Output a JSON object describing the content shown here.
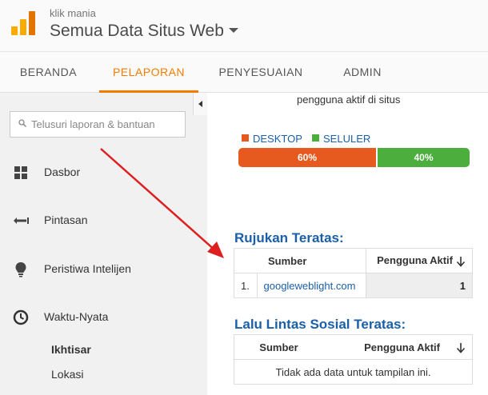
{
  "header": {
    "account": "klik mania",
    "property": "Semua Data Situs Web"
  },
  "nav": {
    "tabs": [
      {
        "label": "BERANDA"
      },
      {
        "label": "PELAPORAN"
      },
      {
        "label": "PENYESUAIAN"
      },
      {
        "label": "ADMIN"
      }
    ],
    "active_tab": "PELAPORAN"
  },
  "sidebar": {
    "search_placeholder": "Telusuri laporan & bantuan",
    "items": [
      {
        "label": "Dasbor",
        "icon": "grid-icon"
      },
      {
        "label": "Pintasan",
        "icon": "shortcut-arrow-icon"
      },
      {
        "label": "Peristiwa Intelijen",
        "icon": "lightbulb-icon"
      },
      {
        "label": "Waktu-Nyata",
        "icon": "clock-icon"
      }
    ],
    "subitems": [
      {
        "label": "Ikhtisar",
        "selected": true
      },
      {
        "label": "Lokasi",
        "selected": false
      }
    ]
  },
  "main": {
    "active_users_caption": "pengguna aktif di situs",
    "device_legend": {
      "desktop": "DESKTOP",
      "mobile": "SELULER"
    },
    "device_split": {
      "desktop_label": "60%",
      "mobile_label": "40%",
      "desktop_fraction": 0.6
    },
    "top_referrals": {
      "title": "Rujukan Teratas:",
      "col_source": "Sumber",
      "col_users": "Pengguna Aktif",
      "rows": [
        {
          "index": "1.",
          "source": "googleweblight.com",
          "users": "1"
        }
      ]
    },
    "top_social": {
      "title": "Lalu Lintas Sosial Teratas:",
      "col_source": "Sumber",
      "col_users": "Pengguna Aktif",
      "empty_message": "Tidak ada data untuk tampilan ini."
    }
  },
  "colors": {
    "accent": "#f57c00",
    "desktop": "#e65a1f",
    "mobile": "#4cae3c",
    "link": "#1a5fa8"
  }
}
